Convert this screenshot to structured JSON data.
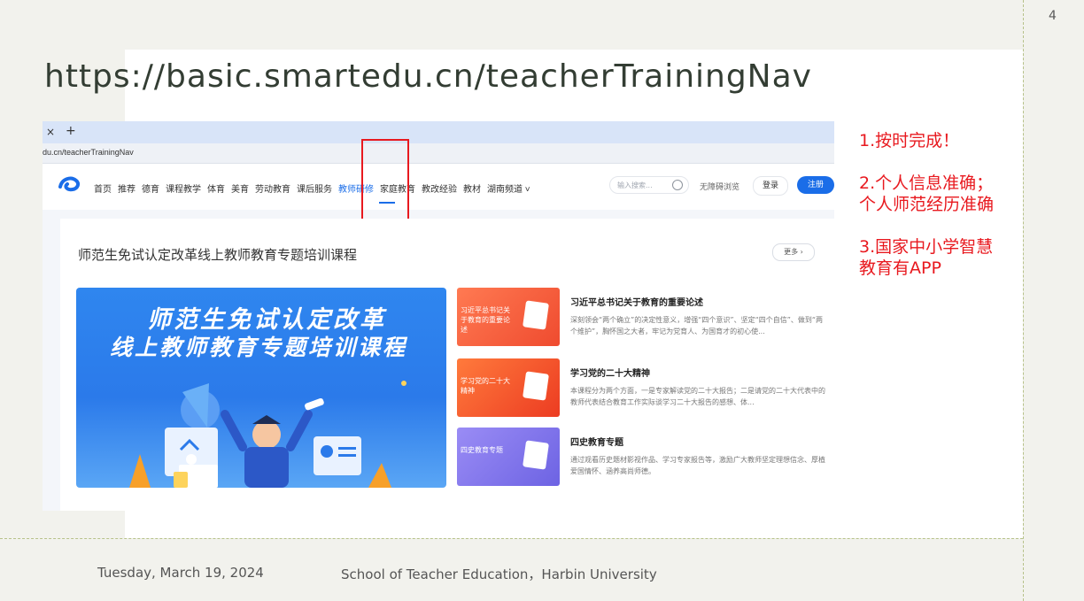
{
  "page_number": "4",
  "slide_title": "https://basic.smartedu.cn/teacherTrainingNav",
  "browser": {
    "tab_close": "×",
    "tab_new": "+",
    "url": "du.cn/teacherTrainingNav"
  },
  "site": {
    "nav": [
      "首页",
      "推荐",
      "德育",
      "课程教学",
      "体育",
      "美育",
      "劳动教育",
      "课后服务",
      "教师研修",
      "家庭教育",
      "教改经验",
      "教材",
      "湖南频道 ˅"
    ],
    "active_nav_index": 8,
    "search_placeholder": "输入搜索...",
    "accessibility": "无障碍浏览",
    "login": "登录",
    "register": "注册",
    "section_title": "师范生免试认定改革线上教师教育专题培训课程",
    "more": "更多 ›",
    "banner_line1": "师范生免试认定改革",
    "banner_line2": "线上教师教育专题培训课程",
    "courses": [
      {
        "thumb": "习近平总书记关于教育的重要论述",
        "title": "习近平总书记关于教育的重要论述",
        "desc": "深刻领会“两个确立”的决定性意义，增强“四个意识”、坚定“四个自信”、做到“两个维护”，胸怀国之大者，牢记为党育人、为国育才的初心使..."
      },
      {
        "thumb": "学习党的二十大精神",
        "title": "学习党的二十大精神",
        "desc": "本课程分为两个方面，一是专家解读党的二十大报告；二是请党的二十大代表中的教师代表结合教育工作实际谈学习二十大报告的感想、体..."
      },
      {
        "thumb": "四史教育专题",
        "title": "四史教育专题",
        "desc": "通过观看历史题材影视作品、学习专家报告等，激励广大教师坚定理想信念、厚植爱国情怀、涵养高尚师德。"
      }
    ]
  },
  "notes": [
    "1.按时完成！",
    "2.个人信息准确；个人师范经历准确",
    "3.国家中小学智慧教育有APP"
  ],
  "footer": {
    "date": "Tuesday, March 19, 2024",
    "school": "School of Teacher Education，Harbin University"
  },
  "colors": {
    "accent": "#1a6de8",
    "highlight": "#e8191f"
  }
}
